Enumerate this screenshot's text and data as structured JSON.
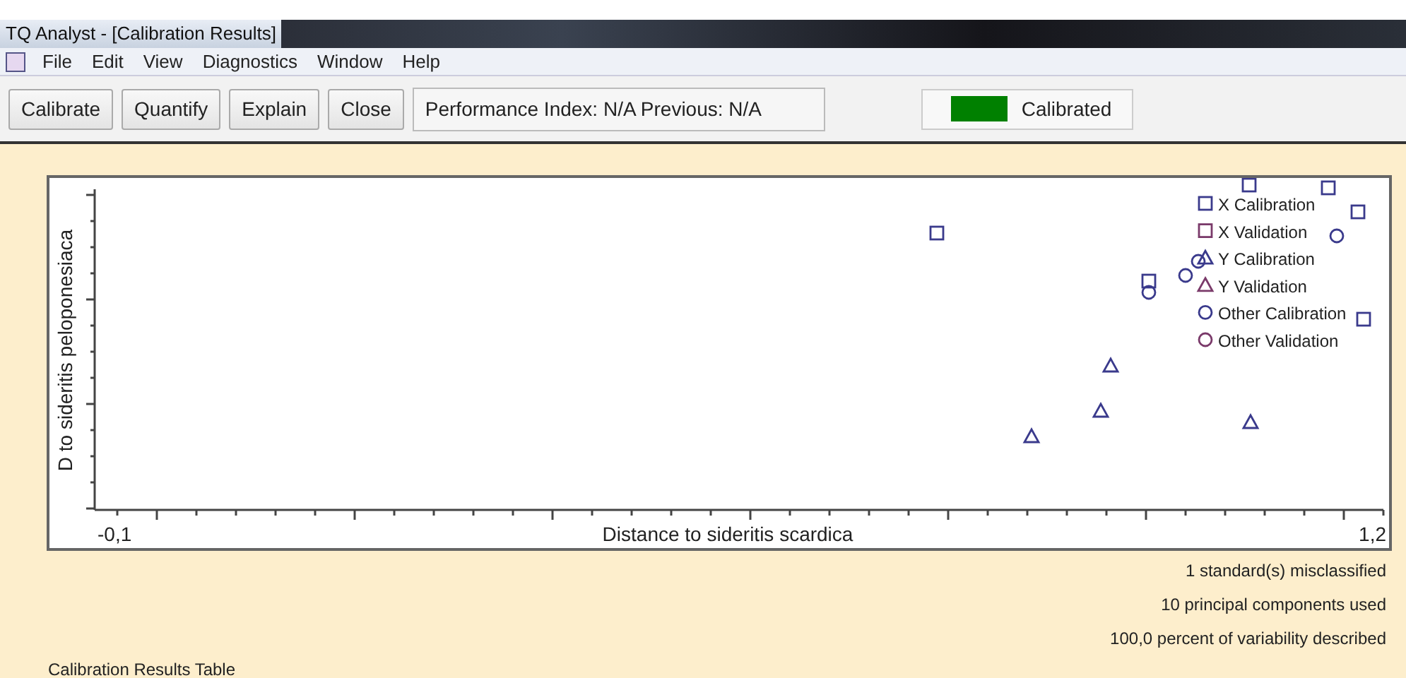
{
  "window": {
    "title": "TQ Analyst  - [Calibration Results]"
  },
  "menu": [
    {
      "label": "File"
    },
    {
      "label": "Edit"
    },
    {
      "label": "View"
    },
    {
      "label": "Diagnostics"
    },
    {
      "label": "Window"
    },
    {
      "label": "Help"
    }
  ],
  "toolbar": {
    "buttons": [
      "Calibrate",
      "Quantify",
      "Explain",
      "Close"
    ],
    "performance": "Performance Index:  N/A  Previous:  N/A",
    "status": {
      "label": "Calibrated",
      "color": "#008000"
    }
  },
  "plot": {
    "ylabel": "D to sideritis peloponesiaca",
    "xlabel": "Distance to sideritis scardica",
    "xmin_label": "-0,1",
    "xmax_label": "1,2",
    "legend": [
      {
        "label": "X Calibration",
        "kind": "square",
        "color": "#3a3a8c"
      },
      {
        "label": "X Validation",
        "kind": "square",
        "color": "#7a3a6a"
      },
      {
        "label": "Y Calibration",
        "kind": "triangle",
        "color": "#3a3a8c"
      },
      {
        "label": "Y Validation",
        "kind": "triangle",
        "color": "#7a3a6a"
      },
      {
        "label": "Other Calibration",
        "kind": "circle",
        "color": "#3a3a8c"
      },
      {
        "label": "Other Validation",
        "kind": "circle",
        "color": "#7a3a6a"
      }
    ]
  },
  "summary": [
    "1 standard(s) misclassified",
    "10 principal components used",
    "100,0 percent of variability described"
  ],
  "table_title": "Calibration Results Table"
}
